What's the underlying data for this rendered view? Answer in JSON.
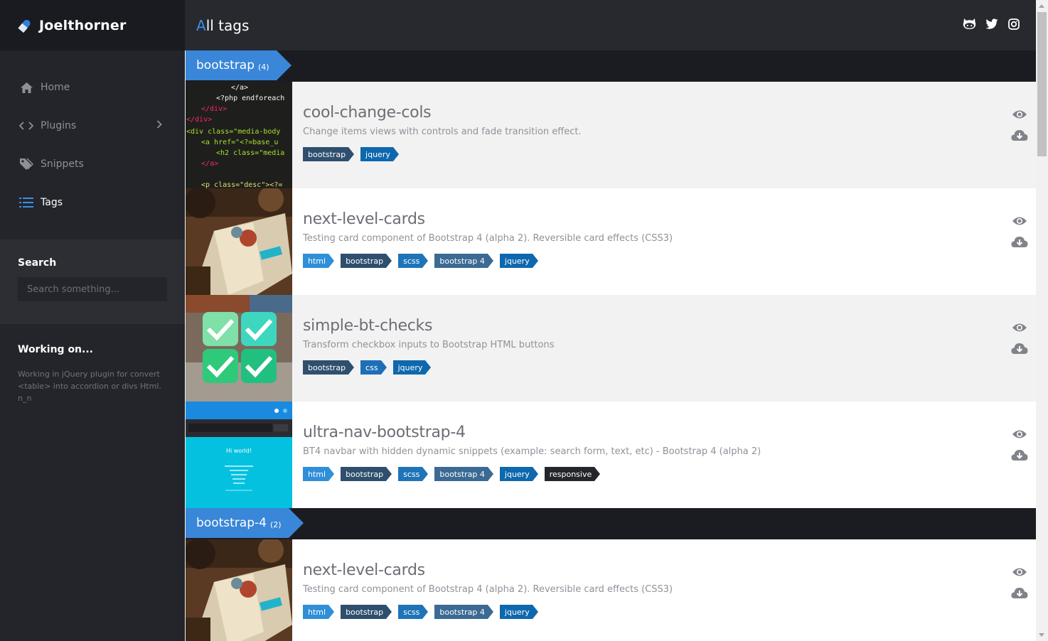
{
  "brand": {
    "name": "Joelthorner"
  },
  "header": {
    "title_first": "A",
    "title_rest": "ll tags"
  },
  "social": [
    "github-icon",
    "twitter-icon",
    "instagram-icon"
  ],
  "nav": [
    {
      "label": "Home",
      "icon": "home-icon",
      "active": false
    },
    {
      "label": "Plugins",
      "icon": "code-icon",
      "active": false
    },
    {
      "label": "Snippets",
      "icon": "tag-icon",
      "active": false
    },
    {
      "label": "Tags",
      "icon": "list-icon",
      "active": true
    }
  ],
  "search": {
    "label": "Search",
    "placeholder": "Search something..."
  },
  "working": {
    "title": "Working on...",
    "text": "Working in jQuery plugin for convert <table> into accordion or divs Html. n_n"
  },
  "colors": {
    "accent": "#3a86d8",
    "badge_html": "#2f8fd8",
    "badge_bootstrap": "#2f4f6e",
    "badge_scss": "#1f74b8",
    "badge_bootstrap4": "#3b6a94",
    "badge_jquery": "#0e68ae",
    "badge_css": "#1f6fb8",
    "badge_responsive": "#24262b"
  },
  "groups": [
    {
      "tag": "bootstrap",
      "count": "(4)",
      "items": [
        {
          "title": "cool-change-cols",
          "desc": "Change items views with controls and fade transition effect.",
          "thumb": "code",
          "badges": [
            "bootstrap",
            "jquery"
          ]
        },
        {
          "title": "next-level-cards",
          "desc": "Testing card component of Bootstrap 4 (alpha 2). Reversible card effects (CSS3)",
          "thumb": "book",
          "badges": [
            "html",
            "bootstrap",
            "scss",
            "bootstrap 4",
            "jquery"
          ]
        },
        {
          "title": "simple-bt-checks",
          "desc": "Transform checkbox inputs to Bootstrap HTML buttons",
          "thumb": "checks",
          "badges": [
            "bootstrap",
            "css",
            "jquery"
          ]
        },
        {
          "title": "ultra-nav-bootstrap-4",
          "desc": "BT4 navbar with hidden dynamic snippets (example: search form, text, etc) - Bootstrap 4 (alpha 2)",
          "thumb": "nav",
          "badges": [
            "html",
            "bootstrap",
            "scss",
            "bootstrap 4",
            "jquery",
            "responsive"
          ]
        }
      ]
    },
    {
      "tag": "bootstrap-4",
      "count": "(2)",
      "items": [
        {
          "title": "next-level-cards",
          "desc": "Testing card component of Bootstrap 4 (alpha 2). Reversible card effects (CSS3)",
          "thumb": "book",
          "badges": [
            "html",
            "bootstrap",
            "scss",
            "bootstrap 4",
            "jquery"
          ]
        }
      ]
    }
  ],
  "thumb_text": {
    "code_lines": [
      "</a>",
      "<?php endforeach",
      "</div>",
      "</div>",
      "<div class=\"media-body",
      "<a href=\"<?=base_u",
      "<h2 class=\"media",
      "</a>",
      "<p class=\"desc\"><?="
    ],
    "nav_title": "Hi world!"
  }
}
